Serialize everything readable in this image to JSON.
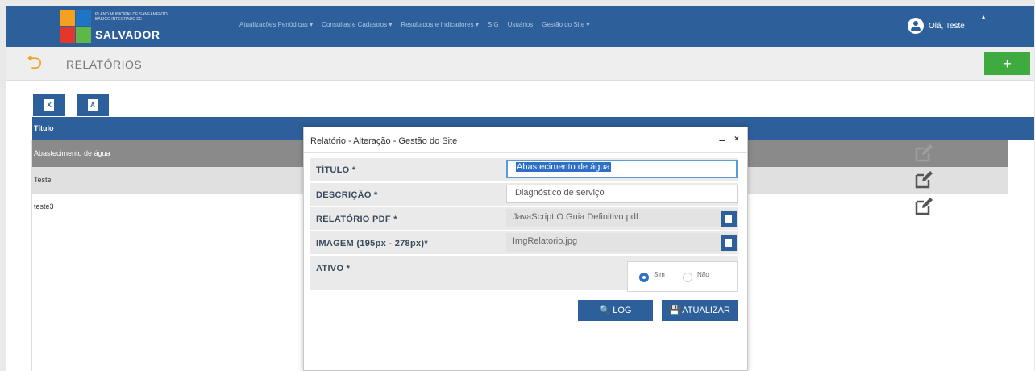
{
  "brand": {
    "tagline": "PLANO MUNICIPAL DE SANEAMENTO BÁSICO INTEGRADO DE",
    "city": "SALVADOR"
  },
  "nav": [
    "Atualizações Periódicas ▾",
    "Consultas e Cadastros ▾",
    "Resultados e Indicadores ▾",
    "SIG",
    "Usuários",
    "Gestão do Site ▾"
  ],
  "user": {
    "greeting": "Olá, Teste"
  },
  "page": {
    "title": "RELATÓRIOS",
    "add_label": "+"
  },
  "export": {
    "excel_label": "X",
    "pdf_label": "A"
  },
  "table": {
    "column_header": "Título",
    "rows": [
      "Abastecimento de água",
      "Teste",
      "teste3"
    ]
  },
  "modal": {
    "title": "Relatório - Alteração - Gestão do Site",
    "minimize": "–",
    "close": "×",
    "fields": {
      "titulo": {
        "label": "TÍTULO *",
        "value": "Abastecimento de água"
      },
      "descricao": {
        "label": "DESCRIÇÃO *",
        "value": "Diagnóstico de serviço"
      },
      "pdf": {
        "label": "RELATÓRIO PDF *",
        "value": "JavaScript O Guia Definitivo.pdf"
      },
      "imagem": {
        "label": "IMAGEM (195px - 278px)*",
        "value": "ImgRelatorio.jpg"
      },
      "ativo": {
        "label": "ATIVO *",
        "option_yes": "Sim",
        "option_no": "Não",
        "selected": "Sim"
      }
    },
    "buttons": {
      "log": "🔍 LOG",
      "update": "💾 ATUALIZAR"
    }
  }
}
